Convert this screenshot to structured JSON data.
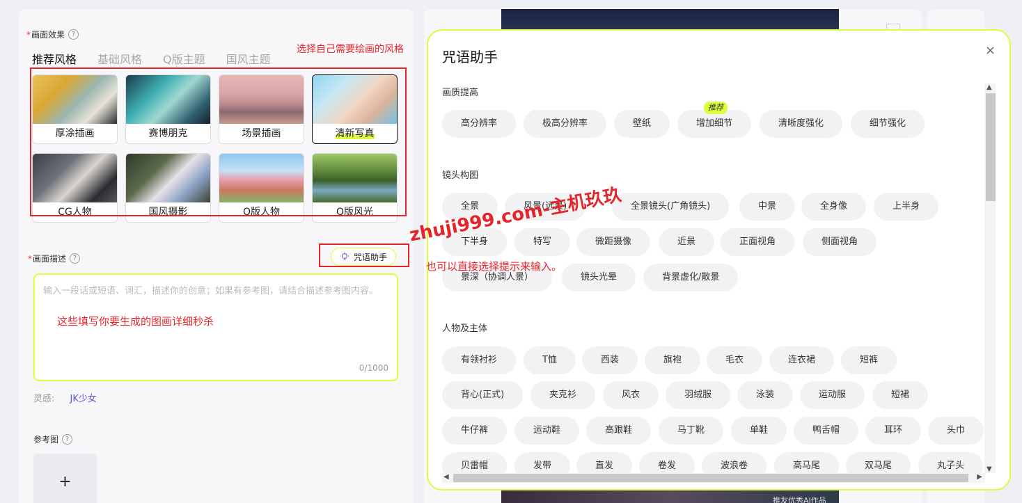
{
  "form": {
    "effect_label": "画面效果",
    "tabs": [
      "推荐风格",
      "基础风格",
      "Q版主题",
      "国风主题"
    ],
    "styles": [
      {
        "name": "厚涂插画",
        "selected": false
      },
      {
        "name": "赛博朋克",
        "selected": false
      },
      {
        "name": "场景插画",
        "selected": false
      },
      {
        "name": "清新写真",
        "selected": true
      },
      {
        "name": "CG人物",
        "selected": false
      },
      {
        "name": "国风摄影",
        "selected": false
      },
      {
        "name": "Q版人物",
        "selected": false
      },
      {
        "name": "Q版风光",
        "selected": false
      }
    ],
    "desc_label": "画面描述",
    "prompt_helper_button": "咒语助手",
    "desc_placeholder": "输入一段话或短语、词汇，描述你的创意；如果有参考图，请结合描述参考图内容。",
    "desc_counter": "0/1000",
    "inspire_label": "灵感:",
    "inspire_value": "JK少女",
    "ref_label": "参考图",
    "upload_symbol": "+"
  },
  "annotations": {
    "style_hint": "选择自己需要绘画的风格",
    "desc_hint": "这些填写你要生成的图画详细秒杀",
    "helper_hint": "也可以直接选择提示来输入。",
    "watermark": "zhuji999.com-主机玖玖"
  },
  "preview": {
    "caption": "推友优秀AI作品"
  },
  "modal": {
    "title": "咒语助手",
    "close_symbol": "×",
    "sections": [
      {
        "title": "画质提高",
        "chips": [
          "高分辨率",
          "极高分辨率",
          "壁纸",
          "增加细节",
          "清晰度强化",
          "细节强化"
        ],
        "badge_chip": "增加细节",
        "badge": "推荐"
      },
      {
        "title": "镜头构图",
        "chips": [
          "全景",
          "风景(远景)",
          "全景镜头(广角镜头)",
          "中景",
          "全身像",
          "上半身",
          "下半身",
          "特写",
          "微距摄像",
          "近景",
          "正面视角",
          "侧面视角",
          "景深（协调人景）",
          "镜头光晕",
          "背景虚化/散景"
        ]
      },
      {
        "title": "人物及主体",
        "chips": [
          "有领衬衫",
          "T恤",
          "西装",
          "旗袍",
          "毛衣",
          "连衣裙",
          "短裤",
          "背心(正式)",
          "夹克衫",
          "风衣",
          "羽绒服",
          "泳装",
          "运动服",
          "短裙",
          "牛仔裤",
          "运动鞋",
          "高跟鞋",
          "马丁靴",
          "单鞋",
          "鸭舌帽",
          "耳环",
          "头巾",
          "贝雷帽",
          "发带",
          "直发",
          "卷发",
          "波浪卷",
          "高马尾",
          "双马尾",
          "丸子头"
        ]
      }
    ]
  },
  "colors": {
    "accent": "#d9ff3d",
    "annotation_red": "#e3262b",
    "link": "#5a55d6"
  }
}
